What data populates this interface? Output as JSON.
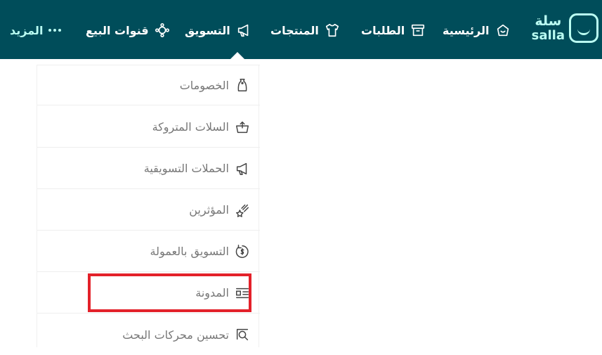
{
  "brand": {
    "name_ar": "سلة",
    "name_en": "salla",
    "accent": "#bafdf2",
    "bar": "#004d5a"
  },
  "nav": {
    "home": "الرئيسية",
    "orders": "الطلبات",
    "products": "المنتجات",
    "marketing": "التسويق",
    "channels": "قنوات البيع",
    "more": "المزيد"
  },
  "menu": {
    "discounts": "الخصومات",
    "abandoned_carts": "السلات المتروكة",
    "campaigns": "الحملات التسويقية",
    "influencers": "المؤثرين",
    "affiliate": "التسويق بالعمولة",
    "blog": "المدونة",
    "seo": "تحسين محركات البحث"
  },
  "highlight_color": "#e3212a"
}
